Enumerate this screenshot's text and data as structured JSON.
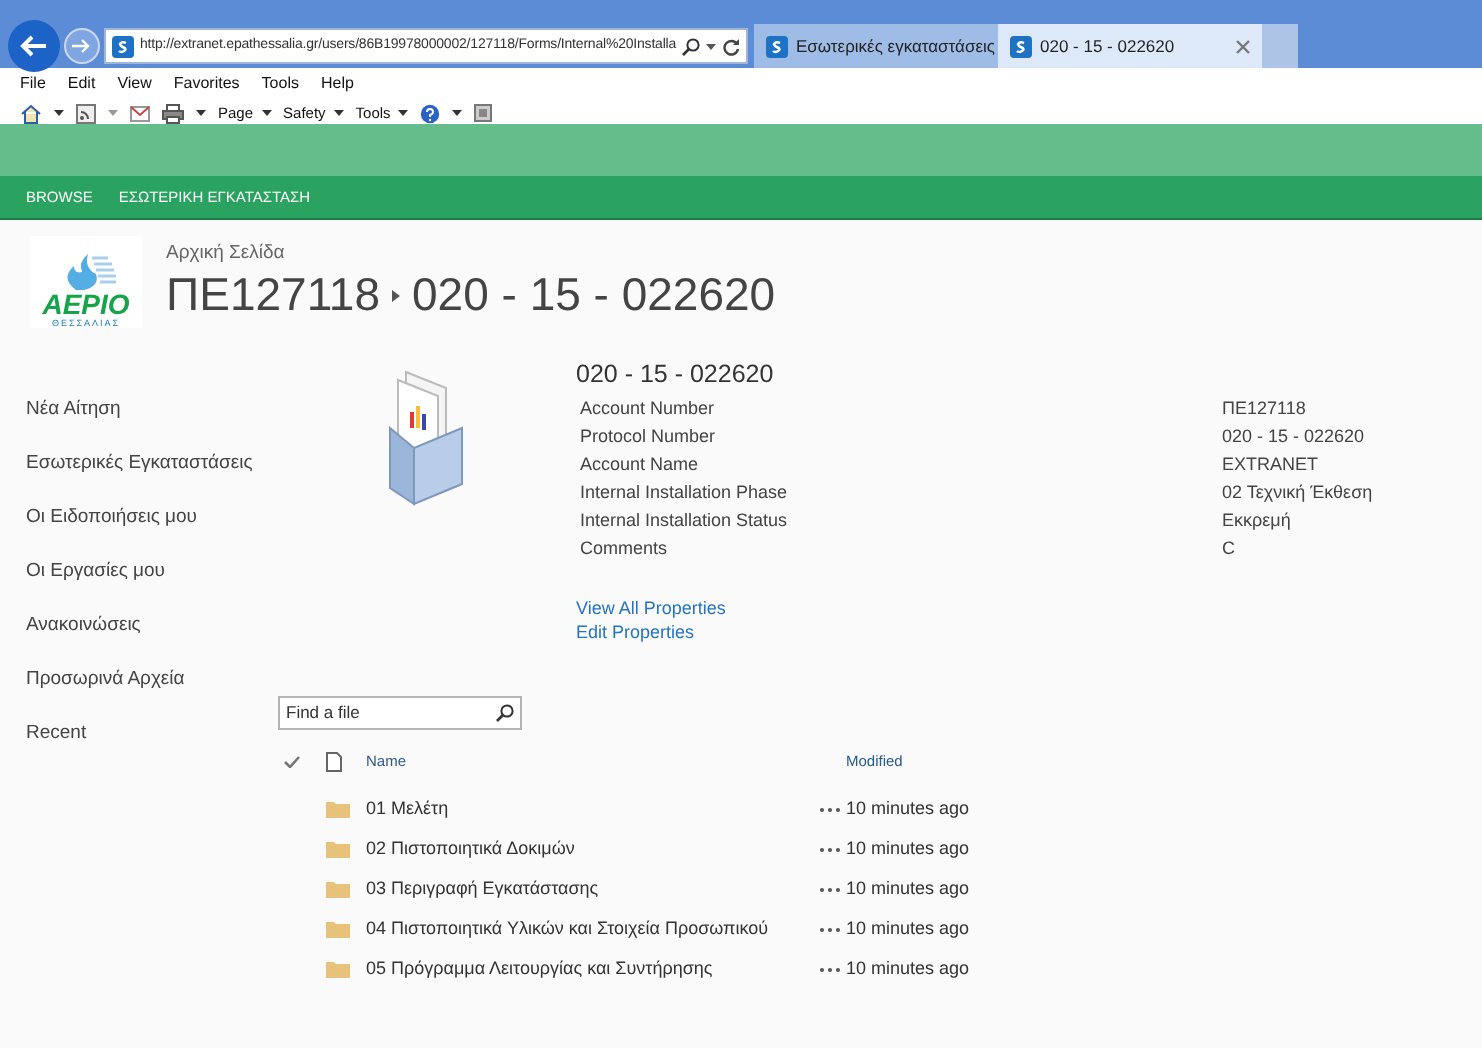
{
  "browser": {
    "address": "http://extranet.epathessalia.gr/users/86B19978000002/127118/Forms/Internal%20Installa",
    "tabs": [
      {
        "label": "Εσωτερικές εγκαταστάσεις",
        "selected": false
      },
      {
        "label": "020 - 15 - 022620",
        "selected": true
      }
    ],
    "menu": [
      "File",
      "Edit",
      "View",
      "Favorites",
      "Tools",
      "Help"
    ],
    "commands": [
      "Page",
      "Safety",
      "Tools"
    ]
  },
  "ribbon": {
    "tabs": [
      "BROWSE",
      "ΕΣΩΤΕΡΙΚΗ ΕΓΚΑΤΑΣΤΑΣΗ"
    ]
  },
  "logo": {
    "name": "ΑΕΡΙΟ",
    "region": "ΘΕΣΣΑΛΙΑΣ"
  },
  "header": {
    "breadcrumb": "Αρχική Σελίδα",
    "title": [
      "ΠΕ127118",
      "020 - 15 - 022620"
    ]
  },
  "sidebar": {
    "items": [
      "Νέα Αίτηση",
      "Εσωτερικές Εγκαταστάσεις",
      "Οι Ειδοποιήσεις μου",
      "Οι Εργασίες μου",
      "Ανακοινώσεις",
      "Προσωρινά Αρχεία",
      "Recent"
    ]
  },
  "properties": {
    "title": "020 - 15 - 022620",
    "rows": [
      {
        "label": "Account Number",
        "value": "ΠΕ127118"
      },
      {
        "label": "Protocol Number",
        "value": "020 - 15 - 022620"
      },
      {
        "label": "Account Name",
        "value": "EXTRANET"
      },
      {
        "label": "Internal Installation Phase",
        "value": "02 Τεχνική Έκθεση"
      },
      {
        "label": "Internal Installation Status",
        "value": "Εκκρεμή"
      },
      {
        "label": "Comments",
        "value": "C"
      }
    ],
    "links": [
      "View All Properties",
      "Edit Properties"
    ]
  },
  "search": {
    "placeholder": "Find a file"
  },
  "table": {
    "columns": [
      "Name",
      "Modified"
    ],
    "rows": [
      {
        "name": "01 Μελέτη",
        "modified": "10 minutes ago"
      },
      {
        "name": "02 Πιστοποιητικά Δοκιμών",
        "modified": "10 minutes ago"
      },
      {
        "name": "03 Περιγραφή Εγκατάστασης",
        "modified": "10 minutes ago"
      },
      {
        "name": "04 Πιστοποιητικά Υλικών και Στοιχεία Προσωπικού",
        "modified": "10 minutes ago"
      },
      {
        "name": "05 Πρόγραμμα Λειτουργίας και Συντήρησης",
        "modified": "10 minutes ago"
      }
    ]
  }
}
